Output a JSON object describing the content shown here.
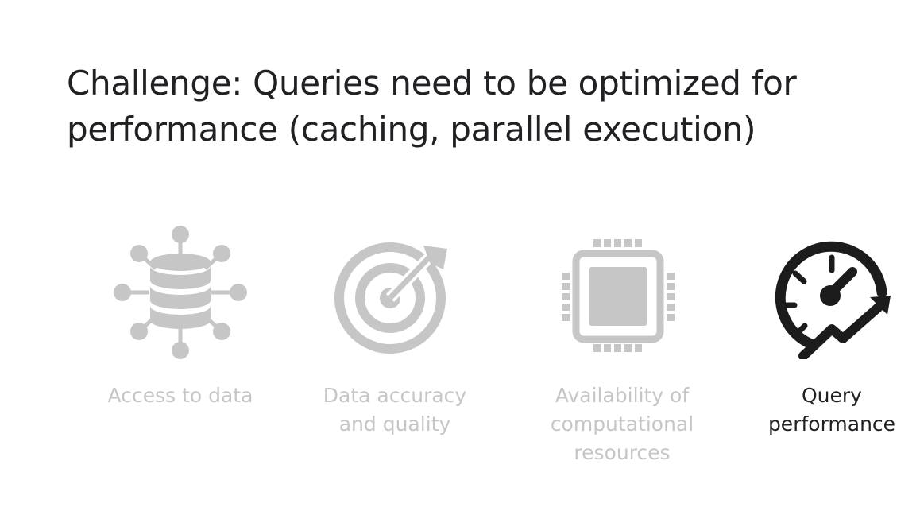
{
  "slide": {
    "title_line1": "Challenge: Queries need to be optimized for",
    "title_line2": "performance (caching, parallel execution)"
  },
  "items": [
    {
      "icon": "database-network-icon",
      "label_lines": [
        "Access to data"
      ],
      "active": false
    },
    {
      "icon": "target-icon",
      "label_lines": [
        "Data accuracy",
        "and quality"
      ],
      "active": false
    },
    {
      "icon": "processor-chip-icon",
      "label_lines": [
        "Availability of",
        "computational",
        "resources"
      ],
      "active": false
    },
    {
      "icon": "speedometer-trend-icon",
      "label_lines": [
        "Query",
        "performance"
      ],
      "active": true
    }
  ],
  "colors": {
    "inactive": "#c6c6c6",
    "active": "#202124"
  }
}
